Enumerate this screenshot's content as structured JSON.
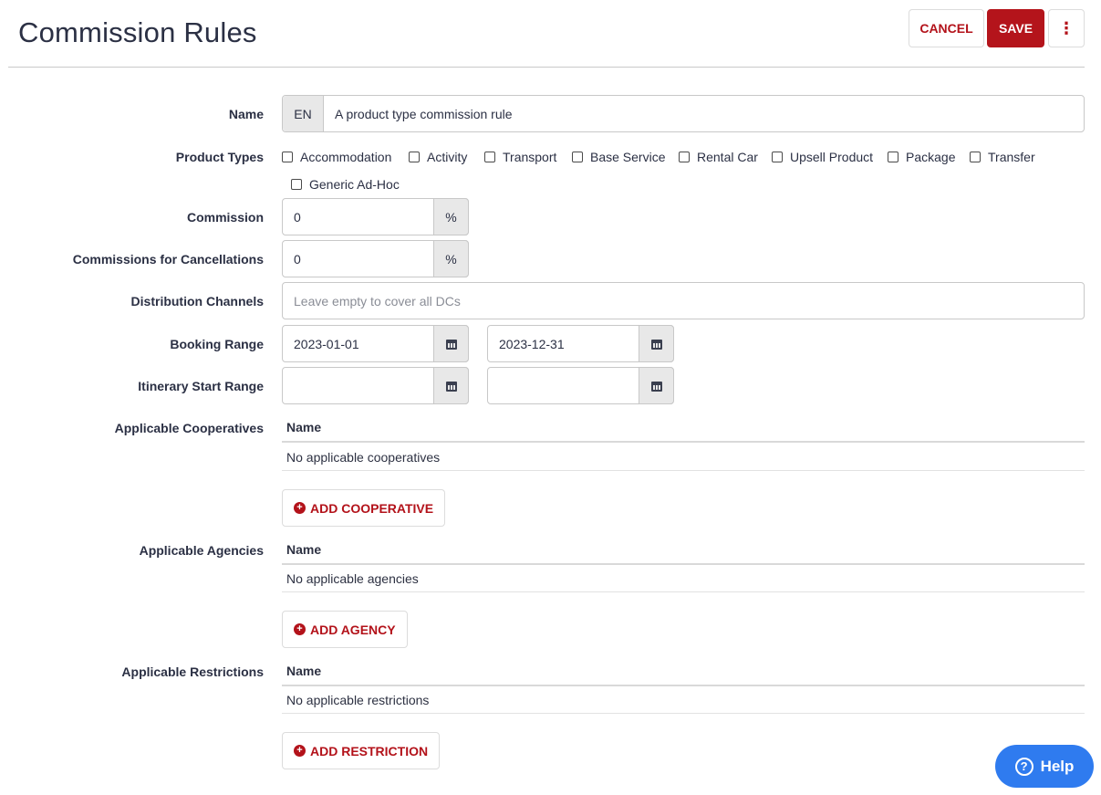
{
  "header": {
    "title": "Commission Rules",
    "cancel_label": "CANCEL",
    "save_label": "SAVE",
    "more_icon": "⋮"
  },
  "colors": {
    "brand_red": "#b4141b",
    "help_blue": "#2f7bef"
  },
  "name_field": {
    "label": "Name",
    "lang": "EN",
    "value": "A product type commission rule"
  },
  "product_types": {
    "label": "Product Types",
    "options": [
      {
        "label": "Accommodation",
        "checked": false
      },
      {
        "label": "Activity",
        "checked": false
      },
      {
        "label": "Transport",
        "checked": false
      },
      {
        "label": "Base Service",
        "checked": false
      },
      {
        "label": "Rental Car",
        "checked": false
      },
      {
        "label": "Upsell Product",
        "checked": false
      },
      {
        "label": "Package",
        "checked": false
      },
      {
        "label": "Transfer",
        "checked": false
      },
      {
        "label": "Generic Ad-Hoc",
        "checked": false
      }
    ]
  },
  "commission": {
    "label": "Commission",
    "value": "0",
    "unit": "%"
  },
  "cancellation_commission": {
    "label": "Commissions for Cancellations",
    "value": "0",
    "unit": "%"
  },
  "distribution_channels": {
    "label": "Distribution Channels",
    "placeholder": "Leave empty to cover all DCs"
  },
  "booking_range": {
    "label": "Booking Range",
    "from": "2023-01-01",
    "to": "2023-12-31"
  },
  "itinerary_range": {
    "label": "Itinerary Start Range",
    "from": "",
    "to": ""
  },
  "cooperatives": {
    "label": "Applicable Cooperatives",
    "col": "Name",
    "empty": "No applicable cooperatives",
    "add": "ADD COOPERATIVE"
  },
  "agencies": {
    "label": "Applicable Agencies",
    "col": "Name",
    "empty": "No applicable agencies",
    "add": "ADD AGENCY"
  },
  "restrictions": {
    "label": "Applicable Restrictions",
    "col": "Name",
    "empty": "No applicable restrictions",
    "add": "ADD RESTRICTION"
  },
  "help": {
    "label": "Help",
    "icon": "?"
  }
}
